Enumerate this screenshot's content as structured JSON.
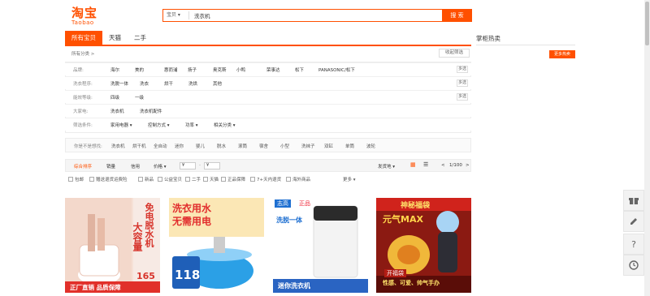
{
  "logo": {
    "cn": "淘宝",
    "en": "Taobao"
  },
  "search": {
    "scope": "宝贝",
    "query": "洗衣机",
    "button": "搜 索"
  },
  "tabs": [
    "所有宝贝",
    "天猫",
    "二手"
  ],
  "side": {
    "title": "掌柜热卖",
    "ad_button": "更多热卖"
  },
  "crumb": "所有分类 >",
  "recv_button": "收起筛选",
  "filters": [
    {
      "label": "品牌:",
      "options": [
        "海尔",
        "美的",
        "惠而浦",
        "扬子",
        "奥克斯",
        "小鸭",
        "荣事达",
        "松下",
        "PANASONIC/松下"
      ],
      "more": "多选"
    },
    {
      "label": "洗衣程序:",
      "options": [
        "洗脱一体",
        "洗衣",
        "烘干",
        "洗烘",
        "其他"
      ],
      "more": "多选"
    },
    {
      "label": "能效等级:",
      "options": [
        "四级",
        "一级"
      ],
      "more": "多选"
    },
    {
      "label": "大家电:",
      "options": [
        "洗衣机",
        "洗衣机配件"
      ],
      "more": ""
    },
    {
      "label": "筛选条件:",
      "options": [
        "家用电器 ▾",
        "控制方式 ▾",
        "功率 ▾",
        "相关分类 ▾"
      ],
      "more": ""
    }
  ],
  "related": {
    "label": "你是不是想找:",
    "items": [
      "洗衣机",
      "烘干机",
      "全自动",
      "迷你",
      "婴儿",
      "脱水",
      "滚筒",
      "宿舍",
      "小型",
      "洗袜子",
      "双缸",
      "单筒",
      "波轮"
    ]
  },
  "sort": {
    "items": [
      "综合排序",
      "销量",
      "信用",
      "价格 ▾"
    ],
    "price_from": "¥",
    "price_to": "¥",
    "ship": "发货地 ▾",
    "page": "1/100"
  },
  "checks": [
    "包邮",
    "赠送退货运费险",
    "新品",
    "公益宝贝",
    "二手",
    "天猫",
    "正品保障",
    "7+天内退货",
    "海外商品",
    "更多 ▾"
  ],
  "products": [
    {
      "text1": "免电脱水机",
      "text2": "大容量",
      "badge": "165",
      "badge_unit": "元",
      "footer": "正厂直销 品质保障"
    },
    {
      "text1": "洗衣用水",
      "text2": "无需用电",
      "badge": "118",
      "badge_unit": "元",
      "footer": ""
    },
    {
      "text1": "洗脱一体",
      "text2": "迷你洗衣机",
      "badge": "志高",
      "badge_unit": "正品",
      "footer": "迷你洗衣机"
    },
    {
      "text1": "神秘福袋",
      "text2": "元气MAX",
      "badge": "开福袋",
      "badge_unit": "",
      "footer": "性感、可爱、帅气手办"
    }
  ],
  "colors": {
    "accent": "#ff5000",
    "text": "#333333"
  }
}
